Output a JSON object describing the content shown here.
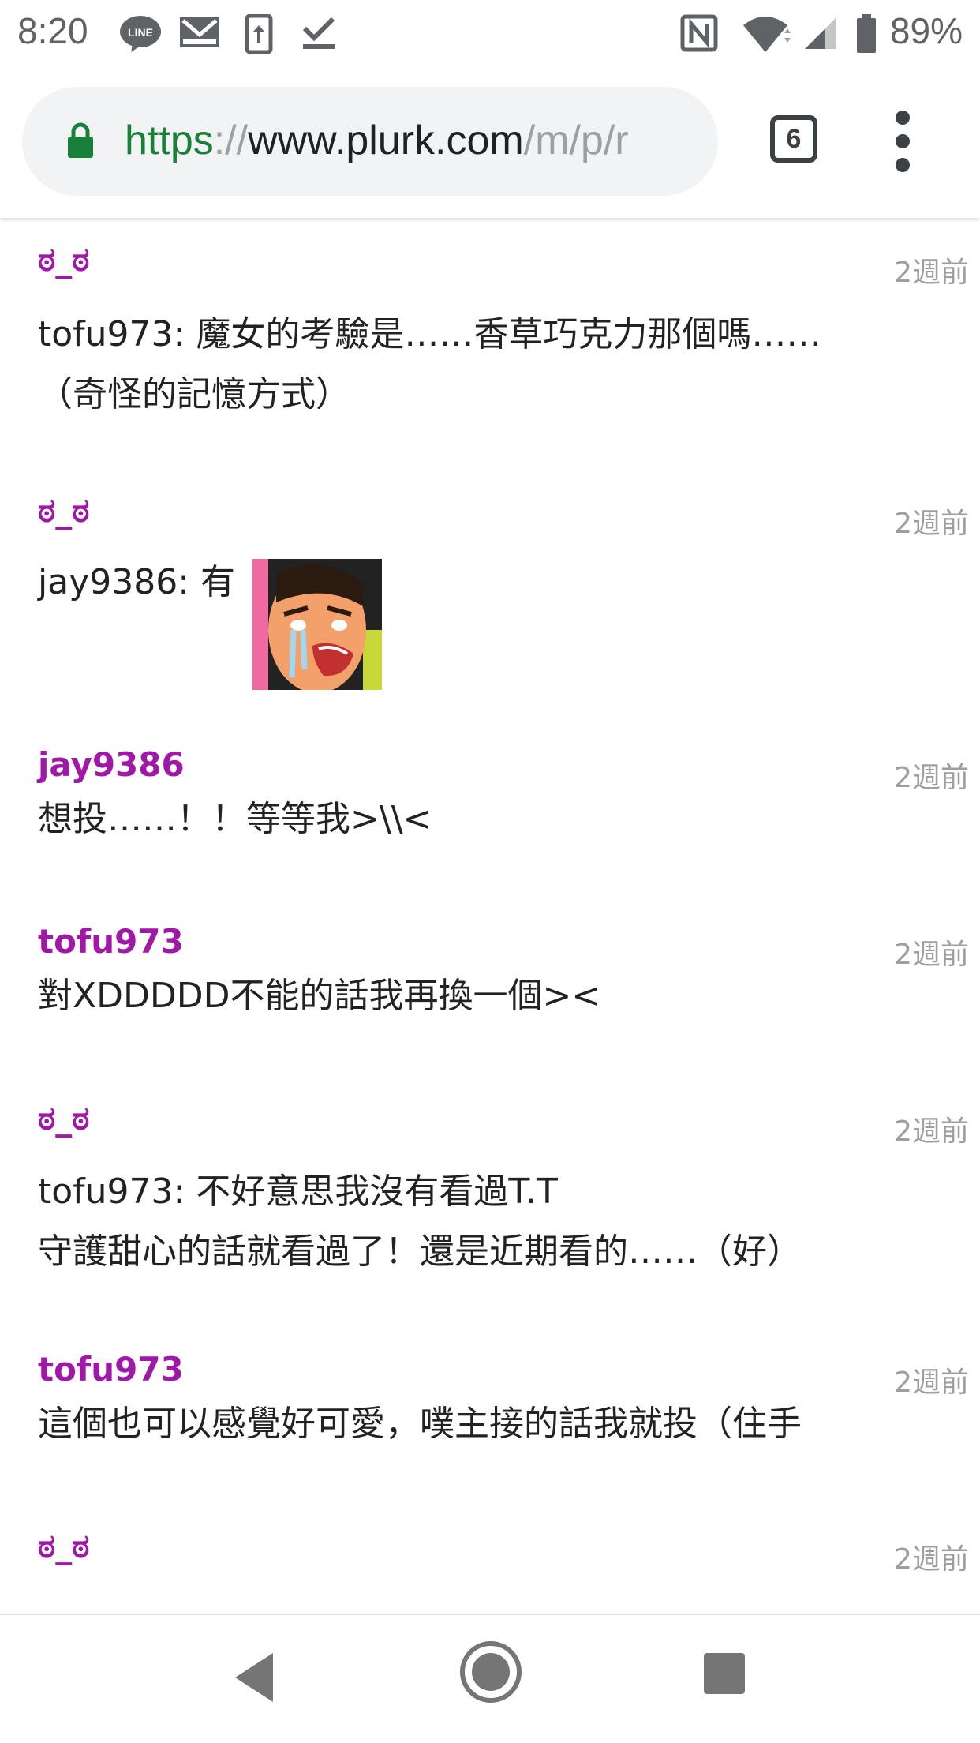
{
  "status_bar": {
    "time": "8:20",
    "battery": "89%",
    "icons": [
      "line-app-icon",
      "gmail-icon",
      "screen-rotation-icon",
      "download-done-icon",
      "nfc-icon",
      "wifi-icon",
      "cell-signal-icon",
      "battery-icon"
    ]
  },
  "browser": {
    "url_scheme": "https",
    "url_separator": "://",
    "url_host": "www.plurk.com",
    "url_path": "/m/p/r",
    "tab_count": "6",
    "secure": true
  },
  "responses": [
    {
      "author": "ಠ_ಠ",
      "time": "2週前",
      "lines": [
        "tofu973: 魔女的考驗是……香草巧克力那個嗎……",
        "（奇怪的記憶方式）"
      ]
    },
    {
      "author": "ಠ_ಠ",
      "time": "2週前",
      "lines": [
        "jay9386: 有"
      ],
      "has_emoticon": true
    },
    {
      "author": "jay9386",
      "time": "2週前",
      "lines": [
        "想投……！！等等我>\\\\<"
      ]
    },
    {
      "author": "tofu973",
      "time": "2週前",
      "lines": [
        "對XDDDDD不能的話我再換一個><"
      ]
    },
    {
      "author": "ಠ_ಠ",
      "time": "2週前",
      "lines": [
        "tofu973: 不好意思我沒有看過T.T",
        "守護甜心的話就看過了！還是近期看的……（好）"
      ]
    },
    {
      "author": "tofu973",
      "time": "2週前",
      "lines": [
        "這個也可以感覺好可愛，噗主接的話我就投（住手"
      ]
    },
    {
      "author": "ಠ_ಠ",
      "time": "2週前",
      "lines": []
    }
  ],
  "nav": {
    "buttons": [
      "back-icon",
      "home-icon",
      "recents-icon"
    ]
  },
  "colors": {
    "author": "#a018a8",
    "timestamp": "#9e9e9e",
    "url_secure": "#188038",
    "url_bar_bg": "#f1f3f4"
  }
}
